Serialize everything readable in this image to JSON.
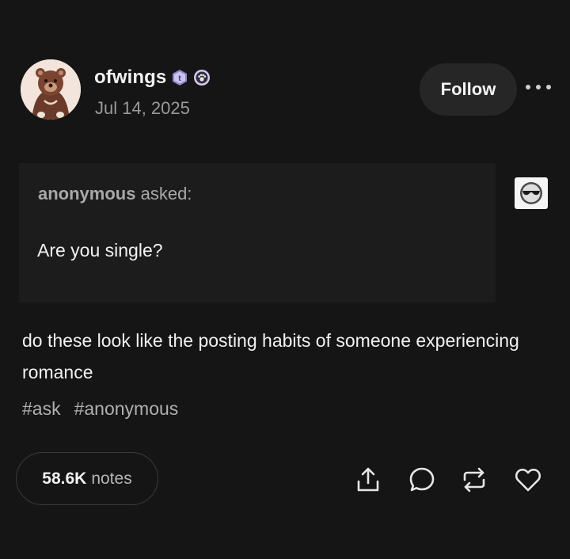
{
  "post": {
    "author": {
      "username": "ofwings",
      "avatar_icon": "bear-avatar-icon",
      "badges": [
        "tumblr-badge-icon",
        "paw-badge-icon"
      ]
    },
    "date": "Jul 14, 2025",
    "follow_label": "Follow",
    "more_icon": "ellipsis-icon",
    "ask": {
      "asker": "anonymous",
      "asked_label": "asked:",
      "question": "Are you single?",
      "asker_avatar_icon": "anonymous-sunglasses-icon"
    },
    "answer": "do these look like the posting habits of someone experiencing romance",
    "tags": [
      "#ask",
      "#anonymous"
    ],
    "notes": {
      "count": "58.6K",
      "label": "notes"
    },
    "actions": [
      "share-icon",
      "reply-icon",
      "reblog-icon",
      "like-icon"
    ]
  }
}
